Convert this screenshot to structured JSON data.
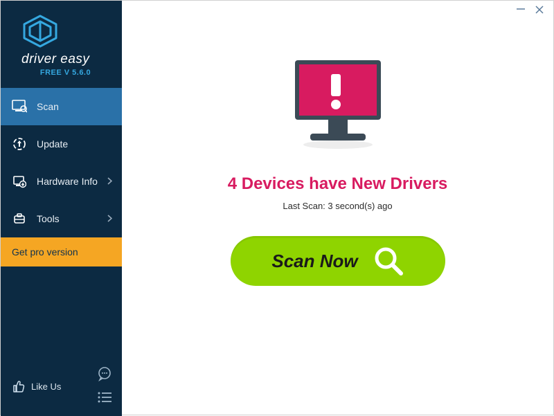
{
  "app": {
    "brand": "driver easy",
    "version": "FREE V 5.6.0"
  },
  "sidebar": {
    "items": [
      {
        "label": "Scan",
        "icon": "scan"
      },
      {
        "label": "Update",
        "icon": "update"
      },
      {
        "label": "Hardware Info",
        "icon": "hardware",
        "chevron": true
      },
      {
        "label": "Tools",
        "icon": "tools",
        "chevron": true
      }
    ],
    "pro_label": "Get pro version",
    "like_label": "Like Us"
  },
  "main": {
    "status_heading": "4 Devices have New Drivers",
    "last_scan": "Last Scan: 3 second(s) ago",
    "scan_button": "Scan Now"
  },
  "colors": {
    "sidebar_bg": "#0c2a42",
    "sidebar_active": "#2a71a8",
    "pro_bg": "#f5a623",
    "accent_pink": "#d81b60",
    "scan_green": "#8fd400",
    "logo_blue": "#35a8e0"
  }
}
